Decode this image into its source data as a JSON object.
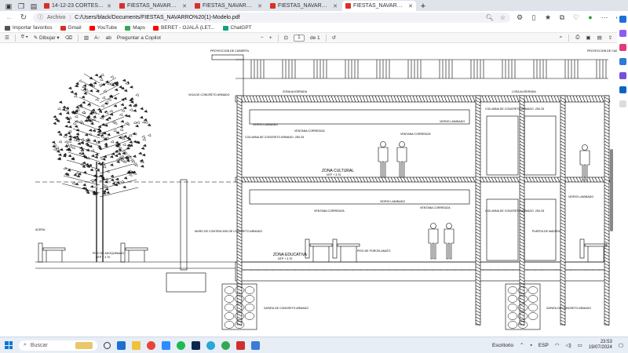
{
  "tabs": [
    {
      "label": "14-12-23 CORTES DETALLADOS",
      "active": false
    },
    {
      "label": "FIESTAS_NAVARRO_ENTREGA_FI",
      "active": false
    },
    {
      "label": "FIESTAS_NAVARRO (1)-Modelo.p",
      "active": false
    },
    {
      "label": "FIESTAS_NAVARRO (1)-Modelo.p",
      "active": false
    },
    {
      "label": "FIESTAS_NAVARRO (1)-Modelo.p",
      "active": true
    }
  ],
  "address": {
    "chip": "Archivo",
    "url": "C:/Users/black/Documents/FIESTAS_NAVARRO%20(1)-Modelo.pdf"
  },
  "bookmarks": [
    {
      "label": "Importar favoritos",
      "color": "#555555"
    },
    {
      "label": "Gmail",
      "color": "#d93025"
    },
    {
      "label": "YouTube",
      "color": "#ff0000"
    },
    {
      "label": "Maps",
      "color": "#34a853"
    },
    {
      "label": "BERET - OJALÁ (LET...",
      "color": "#ff0000"
    },
    {
      "label": "ChatGPT",
      "color": "#10a37f"
    }
  ],
  "pdf_toolbar": {
    "draw_label": "Dibujar",
    "page_value": "1",
    "page_total": "de 1",
    "copilot_label": "Preguntar a Copilot"
  },
  "drawing": {
    "labels": {
      "proy1": "PROYECCION DE CUBIERTA",
      "proy2": "PROYECCION DE CUBIERTA",
      "losa": "ZONA ALIGERADA",
      "losa2": "LOSA ALIGERADA",
      "viga": "VIGA DE CONCRETO ARMADO",
      "vidrio1": "VIDRIO LAMINADO",
      "vidrio2": "VIDRIO LAMINADO",
      "ventana1": "VENTANA CORREDIZA",
      "ventana2": "VENTANA CORREDIZA",
      "ventana3": "VENTANA CORREDIZA",
      "ventana4": "VENTANA CORREDIZA",
      "columna1": "COLUMNA DE CONCRETO ARMADO .25X.25",
      "columna2": "COLUMNA DE CONCRETO ARMADO .25X.25",
      "columna3": "COLUMNA DE CONCRETO ARMADO .25X.25",
      "zona_cultural": "ZONA CULTURAL",
      "ntp_cultural": "NTP + 3.70",
      "zona_educativa": "ZONA EDUCATIVA",
      "ntp_educativa": "NTP + 3.70",
      "piso": "PISO DE ADOQUINADO",
      "ntp_piso": "NTP + 3.70",
      "muro": "MURO DE CONTENCION DE CONCRETO ARMADO",
      "acera": "ACERA",
      "piso_porcelanato": "PISO DE PORCELANATO",
      "zapata1": "ZAPATA DE CONCRETO ARMADO",
      "zapata2": "ZAPATA DE CONCRETO ARMADO",
      "vidrio3": "VIDRIO LAMINADO",
      "vidrio4": "VIDRIO LAMINADO",
      "puerta": "PUERTA DE MADERA"
    }
  },
  "taskbar": {
    "search_placeholder": "Buscar",
    "desktop_label": "Escritorio",
    "lang": "ESP",
    "time": "23:53",
    "date": "19/07/2024"
  }
}
